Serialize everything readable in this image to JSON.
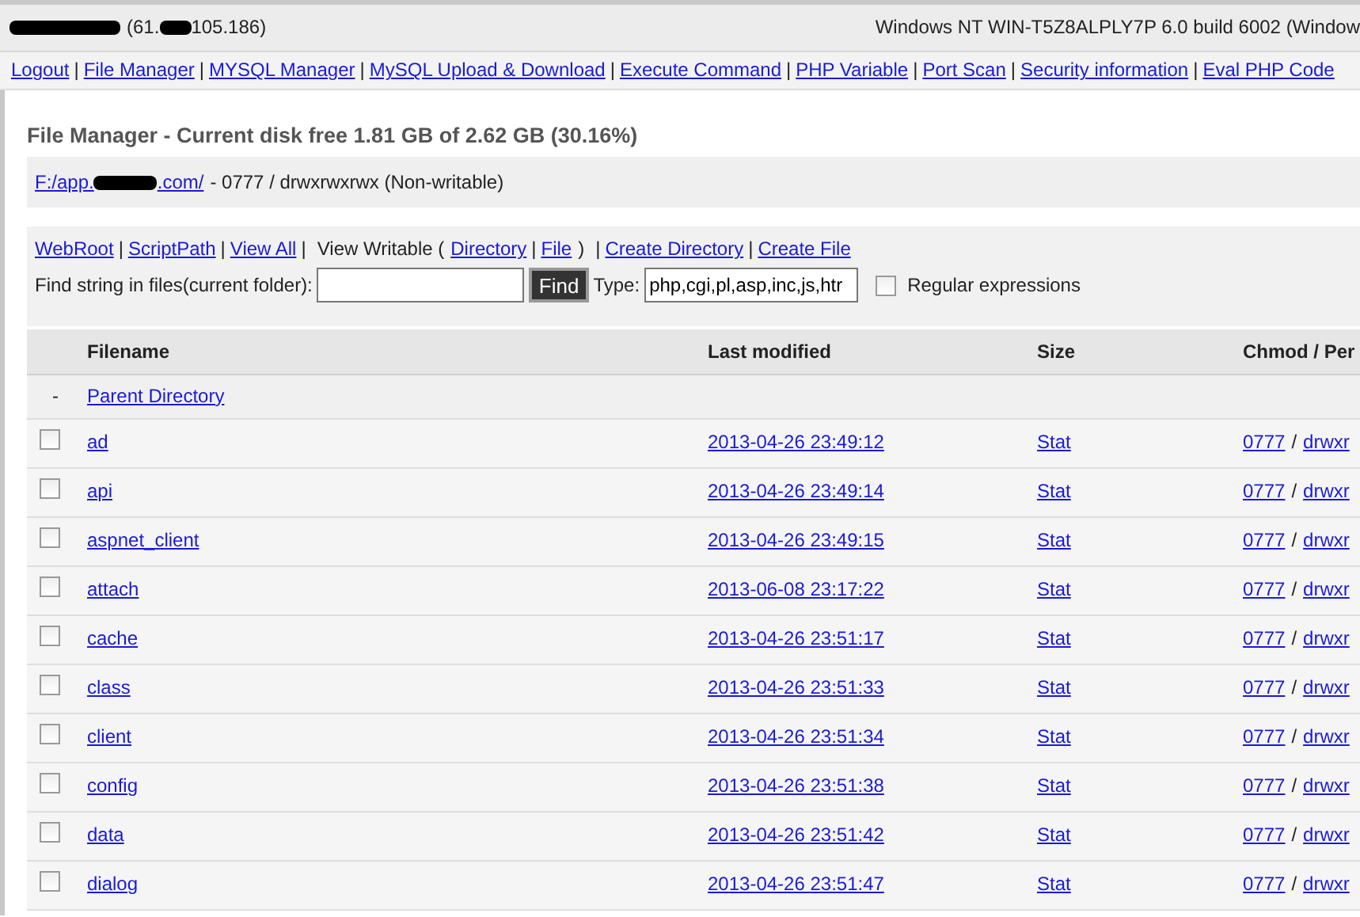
{
  "header": {
    "host_prefix": "(61.",
    "host_suffix": "105.186)",
    "system": "Windows NT WIN-T5Z8ALPLY7P 6.0 build 6002 (Window"
  },
  "nav": [
    {
      "kind": "link",
      "text": "Logout"
    },
    {
      "kind": "sep",
      "text": "|"
    },
    {
      "kind": "link",
      "text": "File Manager"
    },
    {
      "kind": "sep",
      "text": "|"
    },
    {
      "kind": "link",
      "text": "MYSQL Manager"
    },
    {
      "kind": "sep",
      "text": "|"
    },
    {
      "kind": "link",
      "text": "MySQL Upload & Download"
    },
    {
      "kind": "sep",
      "text": "|"
    },
    {
      "kind": "link",
      "text": "Execute Command"
    },
    {
      "kind": "sep",
      "text": "|"
    },
    {
      "kind": "link",
      "text": "PHP Variable"
    },
    {
      "kind": "sep",
      "text": "|"
    },
    {
      "kind": "link",
      "text": "Port Scan"
    },
    {
      "kind": "sep",
      "text": "|"
    },
    {
      "kind": "link",
      "text": "Security information"
    },
    {
      "kind": "sep",
      "text": "|"
    },
    {
      "kind": "link",
      "text": "Eval PHP Code"
    }
  ],
  "title": "File Manager - Current disk free 1.81 GB of 2.62 GB (30.16%)",
  "path": {
    "prefix": "F:/app.",
    "suffix": ".com/",
    "perms": "- 0777 / drwxrwxrwx (Non-writable)"
  },
  "toolbar": [
    {
      "kind": "link",
      "text": "WebRoot"
    },
    {
      "kind": "sep",
      "text": "|"
    },
    {
      "kind": "link",
      "text": "ScriptPath"
    },
    {
      "kind": "sep",
      "text": "|"
    },
    {
      "kind": "link",
      "text": "View All"
    },
    {
      "kind": "sep",
      "text": "|"
    },
    {
      "kind": "text",
      "text": "View Writable ("
    },
    {
      "kind": "link",
      "text": "Directory"
    },
    {
      "kind": "sep",
      "text": "|"
    },
    {
      "kind": "link",
      "text": "File"
    },
    {
      "kind": "text",
      "text": ")"
    },
    {
      "kind": "sep",
      "text": "|"
    },
    {
      "kind": "link",
      "text": "Create Directory"
    },
    {
      "kind": "sep",
      "text": "|"
    },
    {
      "kind": "link",
      "text": "Create File"
    }
  ],
  "search": {
    "label": "Find string in files(current folder):",
    "button": "Find",
    "type_label": "Type:",
    "type_value": "php,cgi,pl,asp,inc,js,htr",
    "regex_label": "Regular expressions",
    "regex_checked": false
  },
  "table": {
    "columns": [
      "Filename",
      "Last modified",
      "Size",
      "Chmod / Per"
    ],
    "parent": {
      "mark": "-",
      "label": "Parent Directory"
    },
    "rows": [
      {
        "name": "ad",
        "modified": "2013-04-26 23:49:12",
        "size": "Stat",
        "chmod": "0777",
        "sep": "/",
        "perm": "drwxr",
        "checked": false
      },
      {
        "name": "api",
        "modified": "2013-04-26 23:49:14",
        "size": "Stat",
        "chmod": "0777",
        "sep": "/",
        "perm": "drwxr",
        "checked": false
      },
      {
        "name": "aspnet_client",
        "modified": "2013-04-26 23:49:15",
        "size": "Stat",
        "chmod": "0777",
        "sep": "/",
        "perm": "drwxr",
        "checked": false
      },
      {
        "name": "attach",
        "modified": "2013-06-08 23:17:22",
        "size": "Stat",
        "chmod": "0777",
        "sep": "/",
        "perm": "drwxr",
        "checked": false
      },
      {
        "name": "cache",
        "modified": "2013-04-26 23:51:17",
        "size": "Stat",
        "chmod": "0777",
        "sep": "/",
        "perm": "drwxr",
        "checked": false
      },
      {
        "name": "class",
        "modified": "2013-04-26 23:51:33",
        "size": "Stat",
        "chmod": "0777",
        "sep": "/",
        "perm": "drwxr",
        "checked": false
      },
      {
        "name": "client",
        "modified": "2013-04-26 23:51:34",
        "size": "Stat",
        "chmod": "0777",
        "sep": "/",
        "perm": "drwxr",
        "checked": false
      },
      {
        "name": "config",
        "modified": "2013-04-26 23:51:38",
        "size": "Stat",
        "chmod": "0777",
        "sep": "/",
        "perm": "drwxr",
        "checked": false
      },
      {
        "name": "data",
        "modified": "2013-04-26 23:51:42",
        "size": "Stat",
        "chmod": "0777",
        "sep": "/",
        "perm": "drwxr",
        "checked": false
      },
      {
        "name": "dialog",
        "modified": "2013-04-26 23:51:47",
        "size": "Stat",
        "chmod": "0777",
        "sep": "/",
        "perm": "drwxr",
        "checked": false
      }
    ]
  }
}
